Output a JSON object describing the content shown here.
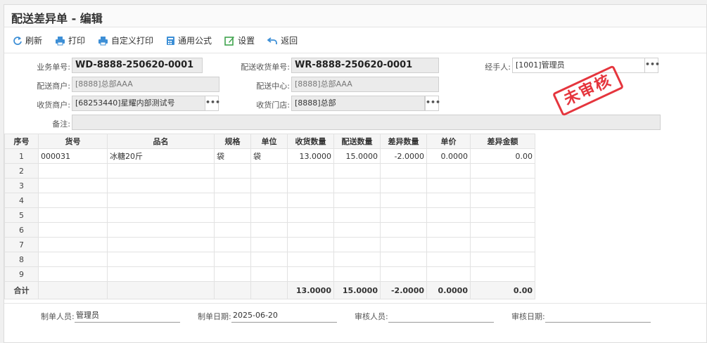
{
  "header": {
    "title": "配送差异单 - 编辑"
  },
  "toolbar": {
    "refresh": "刷新",
    "print": "打印",
    "custom_print": "自定义打印",
    "formula": "通用公式",
    "settings": "设置",
    "back": "返回"
  },
  "form": {
    "biz_no_label": "业务单号:",
    "biz_no": "WD-8888-250620-0001",
    "recv_no_label": "配送收货单号:",
    "recv_no": "WR-8888-250620-0001",
    "handler_label": "经手人:",
    "handler": "[1001]管理员",
    "dist_merchant_label": "配送商户:",
    "dist_merchant": "[8888]总部AAA",
    "dist_center_label": "配送中心:",
    "dist_center": "[8888]总部AAA",
    "recv_merchant_label": "收货商户:",
    "recv_merchant": "[68253440]星耀内部测试号",
    "recv_store_label": "收货门店:",
    "recv_store": "[8888]总部",
    "remark_label": "备注:",
    "remark": "",
    "more_btn": "•••"
  },
  "stamp": "未审核",
  "table": {
    "columns": [
      "序号",
      "货号",
      "品名",
      "规格",
      "单位",
      "收货数量",
      "配送数量",
      "差异数量",
      "单价",
      "差异金额"
    ],
    "rows": [
      [
        "1",
        "000031",
        "冰糖20斤",
        "袋",
        "袋",
        "13.0000",
        "15.0000",
        "-2.0000",
        "0.0000",
        "0.00"
      ],
      [
        "2",
        "",
        "",
        "",
        "",
        "",
        "",
        "",
        "",
        ""
      ],
      [
        "3",
        "",
        "",
        "",
        "",
        "",
        "",
        "",
        "",
        ""
      ],
      [
        "4",
        "",
        "",
        "",
        "",
        "",
        "",
        "",
        "",
        ""
      ],
      [
        "5",
        "",
        "",
        "",
        "",
        "",
        "",
        "",
        "",
        ""
      ],
      [
        "6",
        "",
        "",
        "",
        "",
        "",
        "",
        "",
        "",
        ""
      ],
      [
        "7",
        "",
        "",
        "",
        "",
        "",
        "",
        "",
        "",
        ""
      ],
      [
        "8",
        "",
        "",
        "",
        "",
        "",
        "",
        "",
        "",
        ""
      ],
      [
        "9",
        "",
        "",
        "",
        "",
        "",
        "",
        "",
        "",
        ""
      ]
    ],
    "total": [
      "合计",
      "",
      "",
      "",
      "",
      "13.0000",
      "15.0000",
      "-2.0000",
      "0.0000",
      "0.00"
    ]
  },
  "footer": {
    "creator_label": "制单人员:",
    "creator": "管理员",
    "create_date_label": "制单日期:",
    "create_date": "2025-06-20",
    "auditor_label": "审核人员:",
    "auditor": "",
    "audit_date_label": "审核日期:",
    "audit_date": ""
  },
  "colors": {
    "stamp": "#e5353d",
    "icon": "#3d8fd6",
    "icon_green": "#3fa34d"
  }
}
